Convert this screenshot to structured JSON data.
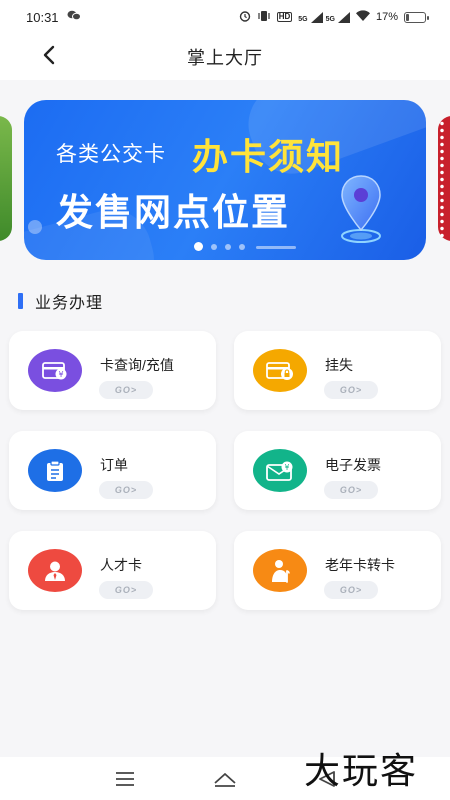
{
  "status_bar": {
    "time": "10:31",
    "battery_text": "17%",
    "battery_level": 0.17,
    "network_labels": [
      "HD",
      "5G",
      "5G"
    ],
    "icons": [
      "wechat-icon",
      "alarm-icon",
      "vibrate-icon",
      "hd-icon",
      "signal-icon",
      "wifi-icon",
      "battery-icon"
    ]
  },
  "header": {
    "title": "掌上大厅",
    "back_icon": "chevron-left-icon"
  },
  "banner": {
    "line1": "各类公交卡",
    "line1_highlight": "办卡须知",
    "line2": "发售网点位置",
    "slide_count": 4,
    "active_slide": 0,
    "colors": {
      "bg": "#2b7ff7",
      "highlight": "#ffe33a"
    }
  },
  "section": {
    "title": "业务办理",
    "accent": "#2f6ff5"
  },
  "services": [
    {
      "label": "卡查询/充值",
      "go": "GO>",
      "icon": "card-yuan-icon",
      "color": "#7a4fe0"
    },
    {
      "label": "挂失",
      "go": "GO>",
      "icon": "card-lock-icon",
      "color": "#f5a800"
    },
    {
      "label": "订单",
      "go": "GO>",
      "icon": "clipboard-icon",
      "color": "#1e6fe6"
    },
    {
      "label": "电子发票",
      "go": "GO>",
      "icon": "invoice-envelope-icon",
      "color": "#12b48a"
    },
    {
      "label": "人才卡",
      "go": "GO>",
      "icon": "person-icon",
      "color": "#ee4a40"
    },
    {
      "label": "老年卡转卡",
      "go": "GO>",
      "icon": "elderly-person-icon",
      "color": "#f78a14"
    }
  ],
  "nav_bar": {
    "icons": [
      "menu-icon",
      "home-icon",
      "back-triangle-icon"
    ]
  },
  "watermark": "大玩客"
}
